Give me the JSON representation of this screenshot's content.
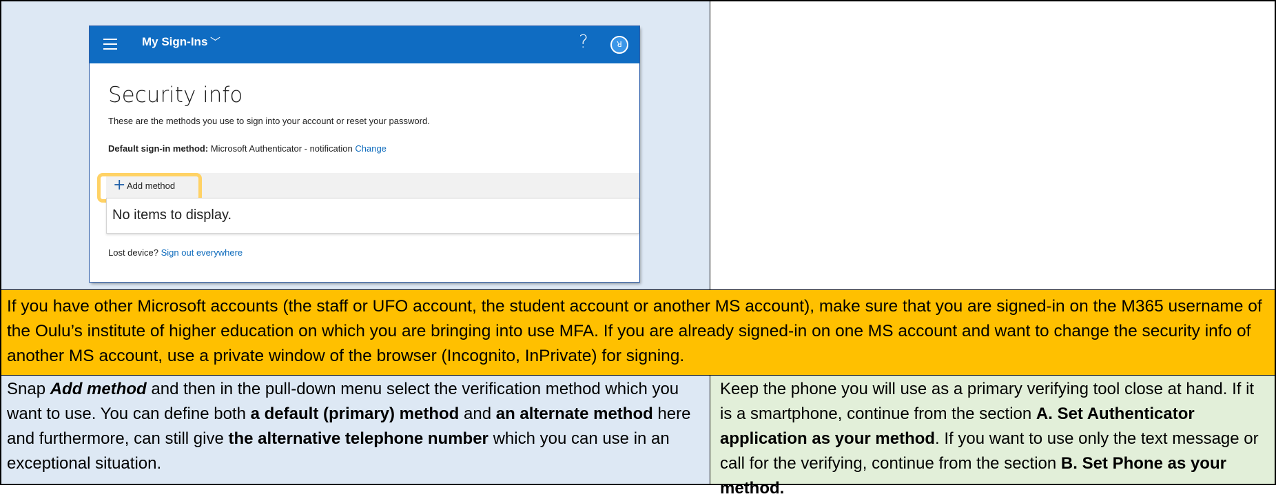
{
  "screenshot": {
    "app_title": "My Sign-Ins",
    "help_symbol": "?",
    "avatar_glyph": "ꓤ",
    "heading": "Security info",
    "description": "These are the methods you use to sign into your account or reset your password.",
    "default_label": "Default sign-in method:",
    "default_value": "Microsoft Authenticator - notification",
    "change_link": "Change",
    "add_method_label": "Add method",
    "no_items": "No items to display.",
    "lost_device": "Lost device?",
    "sign_out_link": "Sign out everywhere",
    "colors": {
      "header": "#0f6cc2",
      "highlight": "#ffd265",
      "link": "#0f6cbd"
    }
  },
  "note": {
    "text": "If you have other Microsoft accounts (the staff or UFO account, the student account or another MS account), make sure that you are signed-in on the M365 username of the Oulu’s institute of higher education on which you are bringing into use MFA. If you are already signed-in on one MS account and want to change the security info of another MS account, use a private window of the browser (Incognito, InPrivate) for signing.",
    "color": "#ffc000"
  },
  "left_instructions": {
    "p1": "Snap ",
    "b1": "Add method",
    "p2": " and then in the pull-down menu select the verification method which you want to use. You can define both ",
    "b2": "a default (primary) method",
    "p3": " and ",
    "b3": "an alternate method",
    "p4": " here and furthermore, can still give ",
    "b4": "the alternative telephone number",
    "p5": " which you can use in an exceptional situation.",
    "color": "#dde8f4"
  },
  "right_instructions": {
    "p1": "Keep the phone you will use as a primary verifying tool close at hand. If it is a smartphone, continue from the section ",
    "b1": "A. Set Authenticator application as your method",
    "p2": ". If you want to use only the text message or call for the verifying, continue from the section ",
    "b2": "B. Set Phone as your method.",
    "color": "#e2efd9"
  }
}
